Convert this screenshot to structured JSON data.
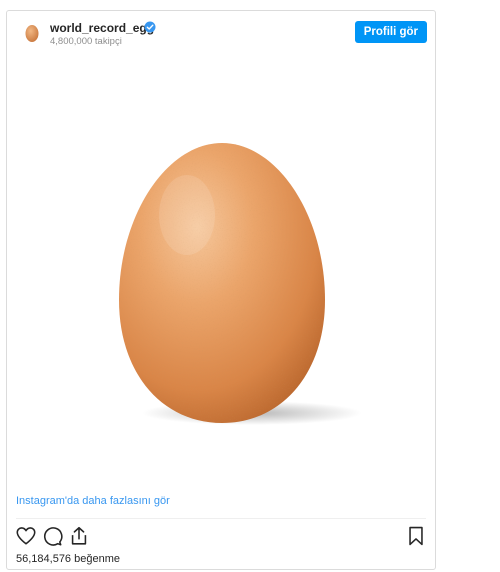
{
  "post": {
    "username": "world_record_egg",
    "followers": "4,800,000 takipçi",
    "profile_button": "Profili gör",
    "more_link": "Instagram'da daha fazlasını gör",
    "likes": "56,184,576 beğenme",
    "verified": true
  },
  "icons": {
    "verified": "verified-badge-icon",
    "like": "heart-icon",
    "comment": "comment-icon",
    "share": "share-icon",
    "save": "bookmark-icon"
  },
  "colors": {
    "accent": "#0095f6",
    "link": "#3897f0",
    "egg": "#e39a5c"
  }
}
